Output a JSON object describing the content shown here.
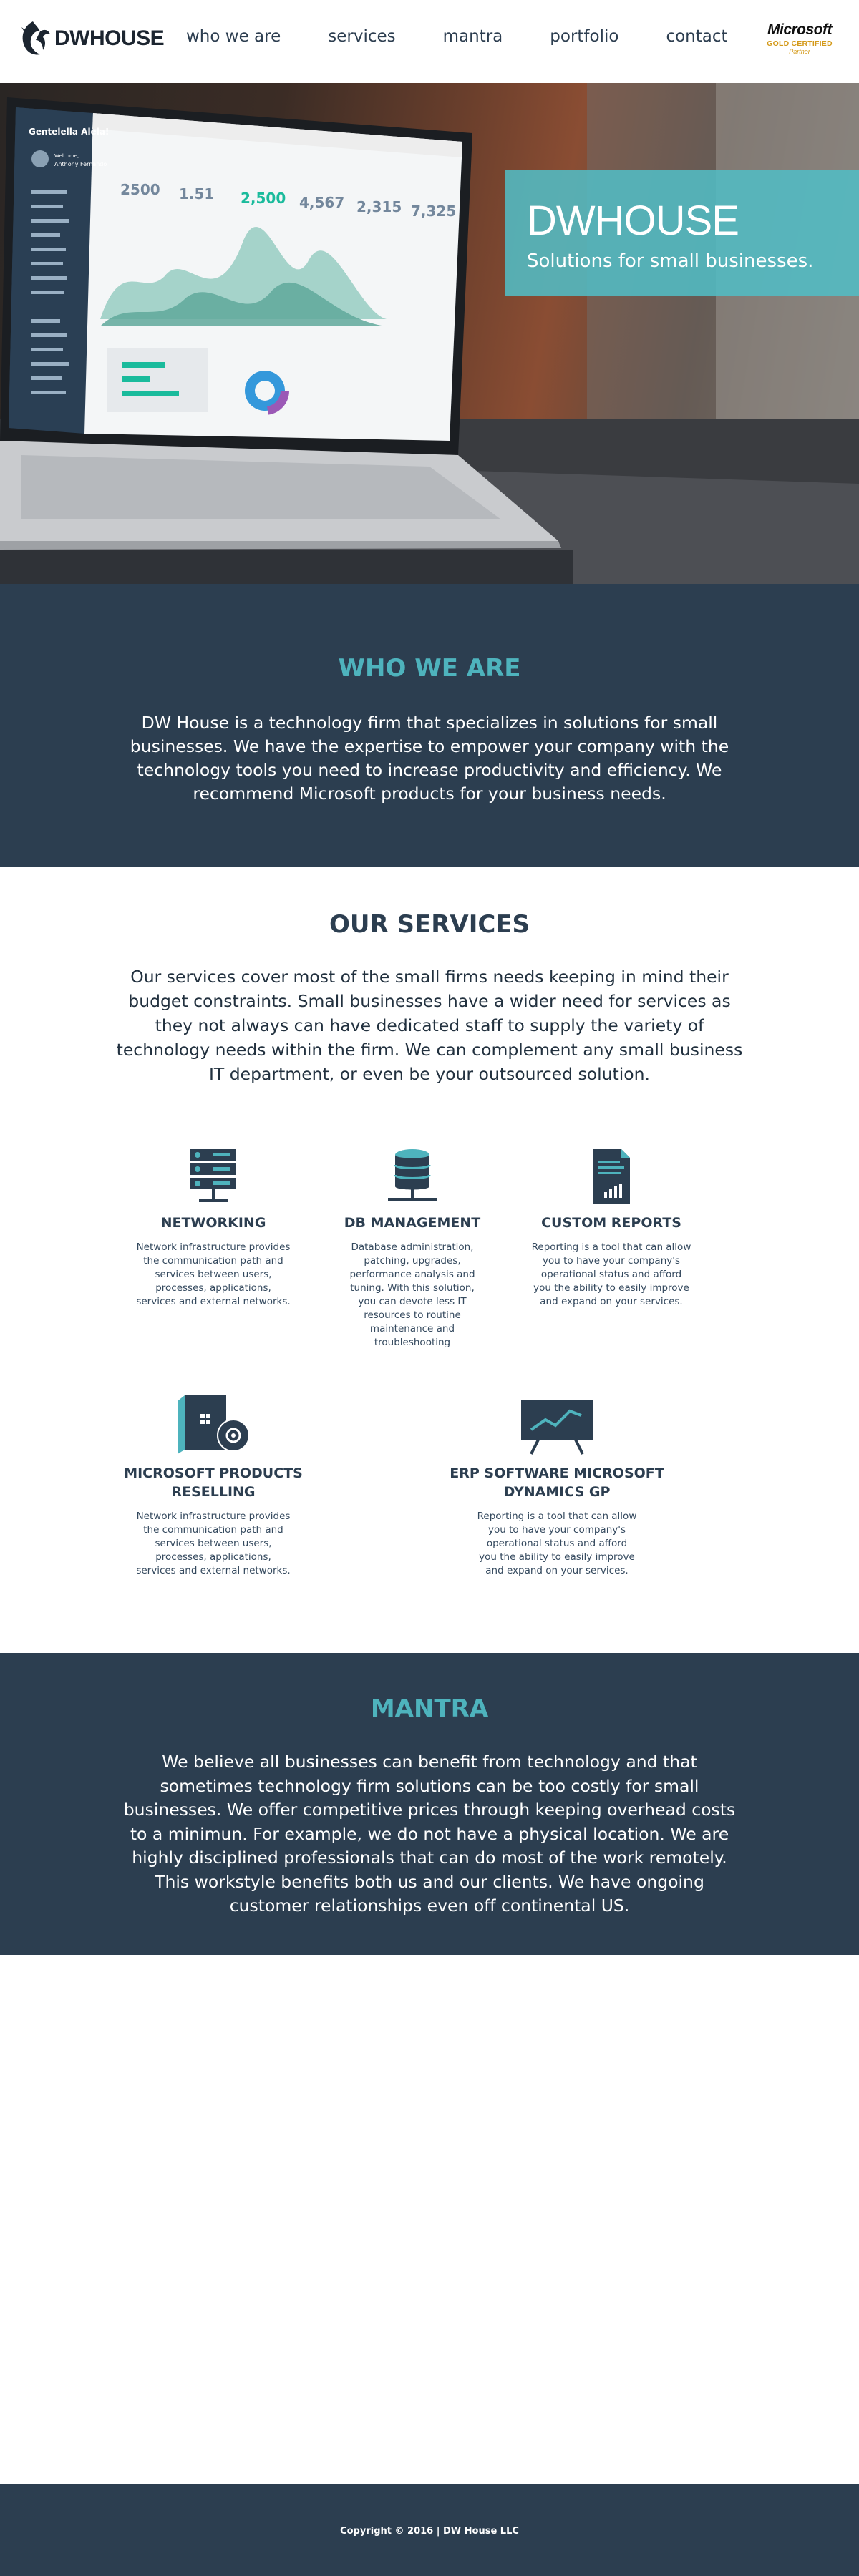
{
  "header": {
    "logo_text": "DWHOUSE",
    "nav": [
      "who we are",
      "services",
      "mantra",
      "portfolio",
      "contact"
    ],
    "badge": {
      "brand": "Microsoft",
      "level": "GOLD CERTIFIED",
      "tier": "Partner"
    }
  },
  "hero": {
    "title": "DWHOUSE",
    "subtitle": "Solutions for small businesses."
  },
  "who_we_are": {
    "title": "WHO WE ARE",
    "body": "DW House is a technology firm that specializes in solutions for small businesses. We have the expertise to empower your company with the technology tools you need to increase productivity and efficiency.  We  recommend Microsoft products for your business needs."
  },
  "services": {
    "title": "OUR SERVICES",
    "intro": "Our services cover most of the small firms needs keeping in mind their budget constraints. Small businesses have a wider need for services as they not always can have dedicated staff to supply the variety of technology needs within the firm. We can complement any small business IT department, or even be your outsourced solution.",
    "items": [
      {
        "icon": "server-rack-icon",
        "title": "NETWORKING",
        "text": "Network infrastructure provides the communication path and services between users, processes, applications, services and external networks."
      },
      {
        "icon": "database-icon",
        "title": "DB MANAGEMENT",
        "text": "Database administration, patching, upgrades, performance analysis and tuning. With this solution, you can devote less IT resources to routine maintenance and troubleshooting"
      },
      {
        "icon": "report-document-icon",
        "title": "CUSTOM REPORTS",
        "text": "Reporting is a tool that can allow you to have your company's operational status and afford you the ability to easily improve and expand on your services."
      },
      {
        "icon": "software-box-icon",
        "title": "MICROSOFT PRODUCTS RESELLING",
        "text": "Network infrastructure provides the communication path and services between users, processes, applications, services and external networks."
      },
      {
        "icon": "presentation-chart-icon",
        "title": "ERP SOFTWARE MICROSOFT DYNAMICS GP",
        "text": "Reporting is a tool that can allow you to have your company's operational status and afford you the ability to easily improve and expand on your services."
      }
    ]
  },
  "mantra": {
    "title": "MANTRA",
    "body": "We believe all businesses can benefit from technology and that sometimes technology firm solutions can be too costly for small businesses. We offer competitive prices through keeping overhead costs to a minimun. For example, we do not have a physical location. We are highly disciplined professionals that can do most of the work remotely. This workstyle benefits both us and our clients. We have ongoing customer relationships even off continental US."
  },
  "hero_screen": {
    "app_name": "Gentelella Alela!",
    "user_greeting": "Welcome,",
    "user_name": "Anthony Fernando",
    "stats": [
      "2500",
      "1.51",
      "2,500",
      "4,567",
      "2,315",
      "7,325"
    ]
  },
  "footer": {
    "copyright": "Copyright © 2016 |  DW House LLC"
  },
  "colors": {
    "navy": "#2c3e50",
    "teal": "#4eb3bd",
    "banner": "#52bcc4"
  }
}
